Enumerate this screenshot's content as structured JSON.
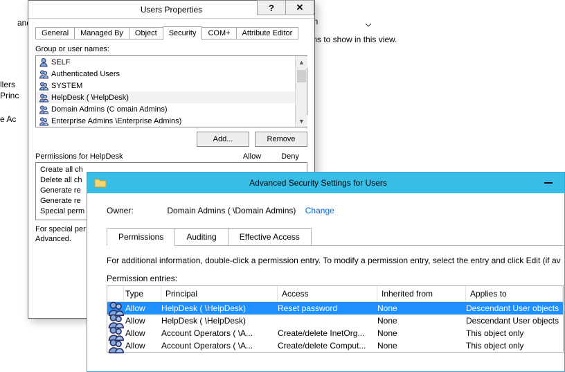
{
  "background": {
    "frag_llers": "llers",
    "frag_princ": "Princ",
    "frag_eac": "e Ac",
    "frag_and": "and C",
    "frag_tion": "tion",
    "msg_noitems": "ms to show in this view."
  },
  "dialog": {
    "title": "Users Properties",
    "help_glyph": "?",
    "close_glyph": "✕",
    "tabs": {
      "general": "General",
      "managed_by": "Managed By",
      "object": "Object",
      "security": "Security",
      "complus": "COM+",
      "attr_editor": "Attribute Editor"
    },
    "group_label": "Group or user names:",
    "list": [
      {
        "name": "SELF",
        "type": "user"
      },
      {
        "name": "Authenticated Users",
        "type": "2user"
      },
      {
        "name": "SYSTEM",
        "type": "2user"
      },
      {
        "name": "HelpDesk (          \\HelpDesk)",
        "type": "2user",
        "selected": true
      },
      {
        "name": "Domain Admins (C           omain Admins)",
        "type": "2user"
      },
      {
        "name": "Enterprise Admins             \\Enterprise Admins)",
        "type": "2user"
      }
    ],
    "btn_add": "Add...",
    "btn_remove": "Remove",
    "perm_label": "Permissions for HelpDesk",
    "col_allow": "Allow",
    "col_deny": "Deny",
    "perm_rows": [
      "Create all ch",
      "Delete all ch",
      "Generate re",
      "Generate re",
      "Special perm"
    ],
    "footer1": "For special per",
    "footer2": "Advanced."
  },
  "advanced": {
    "title": "Advanced Security Settings for Users",
    "owner_label": "Owner:",
    "owner_value": "Domain Admins (          \\Domain Admins)",
    "change": "Change",
    "tabs": {
      "permissions": "Permissions",
      "auditing": "Auditing",
      "effective": "Effective Access"
    },
    "note": "For additional information, double-click a permission entry. To modify a permission entry, select the entry and click Edit (if av",
    "entries_label": "Permission entries:",
    "columns": {
      "type": "Type",
      "principal": "Principal",
      "access": "Access",
      "inherited": "Inherited from",
      "applies": "Applies to"
    },
    "rows": [
      {
        "type": "Allow",
        "principal": "HelpDesk (        \\HelpDesk)",
        "access": "Reset password",
        "inherited": "None",
        "applies": "Descendant User objects",
        "selected": true
      },
      {
        "type": "Allow",
        "principal": "HelpDesk (        \\HelpDesk)",
        "access": "",
        "inherited": "None",
        "applies": "Descendant User objects"
      },
      {
        "type": "Allow",
        "principal": "Account Operators (        \\A...",
        "access": "Create/delete InetOrg...",
        "inherited": "None",
        "applies": "This object only"
      },
      {
        "type": "Allow",
        "principal": "Account Operators (        \\A...",
        "access": "Create/delete Comput...",
        "inherited": "None",
        "applies": "This object only"
      }
    ]
  }
}
